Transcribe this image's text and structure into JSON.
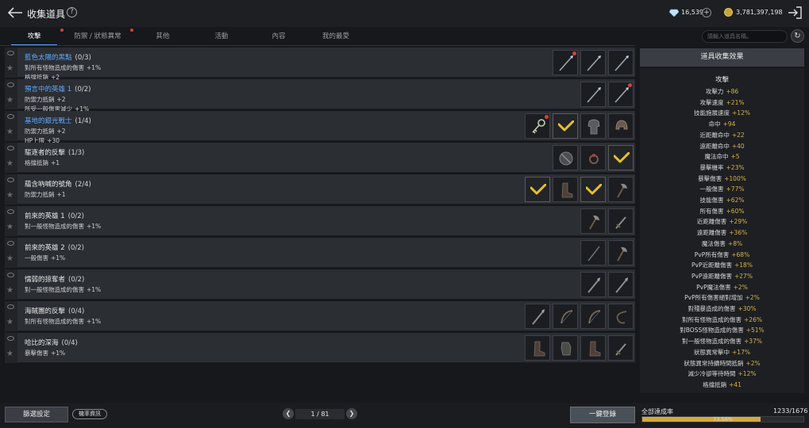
{
  "header": {
    "title": "收集道具",
    "gems": "16,539",
    "coins": "3,781,397,198"
  },
  "tabs": [
    {
      "label": "攻擊",
      "active": true,
      "notify": true
    },
    {
      "label": "防禦 / 狀態異常",
      "active": false,
      "notify": true
    },
    {
      "label": "其他",
      "active": false,
      "notify": false
    },
    {
      "label": "活動",
      "active": false,
      "notify": false
    },
    {
      "label": "內容",
      "active": false,
      "notify": false
    },
    {
      "label": "我的最愛",
      "active": false,
      "notify": false
    }
  ],
  "search": {
    "placeholder": "請輸入道具名稱。"
  },
  "rows": [
    {
      "name": "藍色太陽的黑點",
      "count": "(0/3)",
      "highlight": true,
      "stats": [
        {
          "label": "對所有怪物造成的傷害",
          "value": "+1%"
        },
        {
          "label": "格擋抵銷",
          "value": "+2"
        }
      ],
      "slots": [
        "spear-red",
        "spear",
        "spear"
      ]
    },
    {
      "name": "預言中的英雄 1",
      "count": "(0/2)",
      "highlight": true,
      "stats": [
        {
          "label": "防禦力抵銷",
          "value": "+2"
        },
        {
          "label": "所受一般傷害減少",
          "value": "+1%"
        }
      ],
      "slots": [
        "spear",
        "spear-red"
      ]
    },
    {
      "name": "基地的銀光戰士",
      "count": "(1/4)",
      "highlight": true,
      "stats": [
        {
          "label": "防禦力抵銷",
          "value": "+2"
        },
        {
          "label": "HP上限",
          "value": "+30"
        }
      ],
      "slots": [
        "key-red",
        "check",
        "armor",
        "helm"
      ]
    },
    {
      "name": "驅逐者的反擊",
      "count": "(1/3)",
      "highlight": false,
      "stats": [
        {
          "label": "格擋抵銷",
          "value": "+1"
        }
      ],
      "slots": [
        "shield",
        "ring",
        "check"
      ]
    },
    {
      "name": "蘊含吶喊的號角",
      "count": "(2/4)",
      "highlight": false,
      "stats": [
        {
          "label": "防禦力抵銷",
          "value": "+1"
        }
      ],
      "slots": [
        "check",
        "boot",
        "check",
        "axe"
      ]
    },
    {
      "name": "前來的英雄 1",
      "count": "(0/2)",
      "highlight": false,
      "stats": [
        {
          "label": "對一般怪物造成的傷害",
          "value": "+1%"
        }
      ],
      "slots": [
        "axe",
        "sword"
      ]
    },
    {
      "name": "前來的英雄 2",
      "count": "(0/2)",
      "highlight": false,
      "stats": [
        {
          "label": "一般傷害",
          "value": "+1%"
        }
      ],
      "slots": [
        "staff",
        "axe"
      ]
    },
    {
      "name": "懦弱的掠奪者",
      "count": "(0/2)",
      "highlight": false,
      "stats": [
        {
          "label": "對一般怪物造成的傷害",
          "value": "+1%"
        }
      ],
      "slots": [
        "blade",
        "blade"
      ]
    },
    {
      "name": "海賊團的反擊",
      "count": "(0/4)",
      "highlight": false,
      "stats": [
        {
          "label": "對所有怪物造成的傷害",
          "value": "+1%"
        }
      ],
      "slots": [
        "blade",
        "bow",
        "bow",
        "whip"
      ]
    },
    {
      "name": "哈比的深海",
      "count": "(0/4)",
      "highlight": false,
      "stats": [
        {
          "label": "暴擊傷害",
          "value": "+1%"
        }
      ],
      "slots": [
        "boot",
        "gauntlet",
        "boot",
        "sword"
      ]
    }
  ],
  "panel": {
    "title": "道具收集效果",
    "section": "攻擊",
    "effects": [
      {
        "label": "攻擊力",
        "value": "+86"
      },
      {
        "label": "攻擊速度",
        "value": "+21%"
      },
      {
        "label": "技能施展速度",
        "value": "+12%"
      },
      {
        "label": "命中",
        "value": "+94"
      },
      {
        "label": "近距離命中",
        "value": "+22"
      },
      {
        "label": "遠距離命中",
        "value": "+40"
      },
      {
        "label": "魔法命中",
        "value": "+5"
      },
      {
        "label": "暴擊機率",
        "value": "+23%"
      },
      {
        "label": "暴擊傷害",
        "value": "+100%"
      },
      {
        "label": "一般傷害",
        "value": "+77%"
      },
      {
        "label": "技能傷害",
        "value": "+62%"
      },
      {
        "label": "所有傷害",
        "value": "+60%"
      },
      {
        "label": "近距離傷害",
        "value": "+29%"
      },
      {
        "label": "遠距離傷害",
        "value": "+36%"
      },
      {
        "label": "魔法傷害",
        "value": "+8%"
      },
      {
        "label": "PvP所有傷害",
        "value": "+68%"
      },
      {
        "label": "PvP近距離傷害",
        "value": "+18%"
      },
      {
        "label": "PvP遠距離傷害",
        "value": "+27%"
      },
      {
        "label": "PvP魔法傷害",
        "value": "+2%"
      },
      {
        "label": "PvP所有傷害絕對增加",
        "value": "+2%"
      },
      {
        "label": "對殘暴造成的傷害",
        "value": "+30%"
      },
      {
        "label": "對所有怪物造成的傷害",
        "value": "+26%"
      },
      {
        "label": "對BOSS怪物造成的傷害",
        "value": "+51%"
      },
      {
        "label": "對一般怪物造成的傷害",
        "value": "+37%"
      },
      {
        "label": "狀態異常擊中",
        "value": "+17%"
      },
      {
        "label": "狀態異常持續時間抵銷",
        "value": "+2%"
      },
      {
        "label": "減少冷卻等待時間",
        "value": "+12%"
      },
      {
        "label": "格擋抵銷",
        "value": "+41"
      }
    ]
  },
  "footer": {
    "filter_label": "篩選設定",
    "prob_label": "機率資訊",
    "page": "1 / 81",
    "register_label": "一鍵登錄",
    "rate_label": "全部達成率",
    "rate_count": "1233/1676",
    "rate_pct": "73.56%",
    "rate_fraction": 0.7356
  },
  "colors": {
    "accent": "#5ea8ff",
    "gold": "#d4b24a",
    "check": "#e6c02a",
    "alert": "#e23b3b"
  }
}
